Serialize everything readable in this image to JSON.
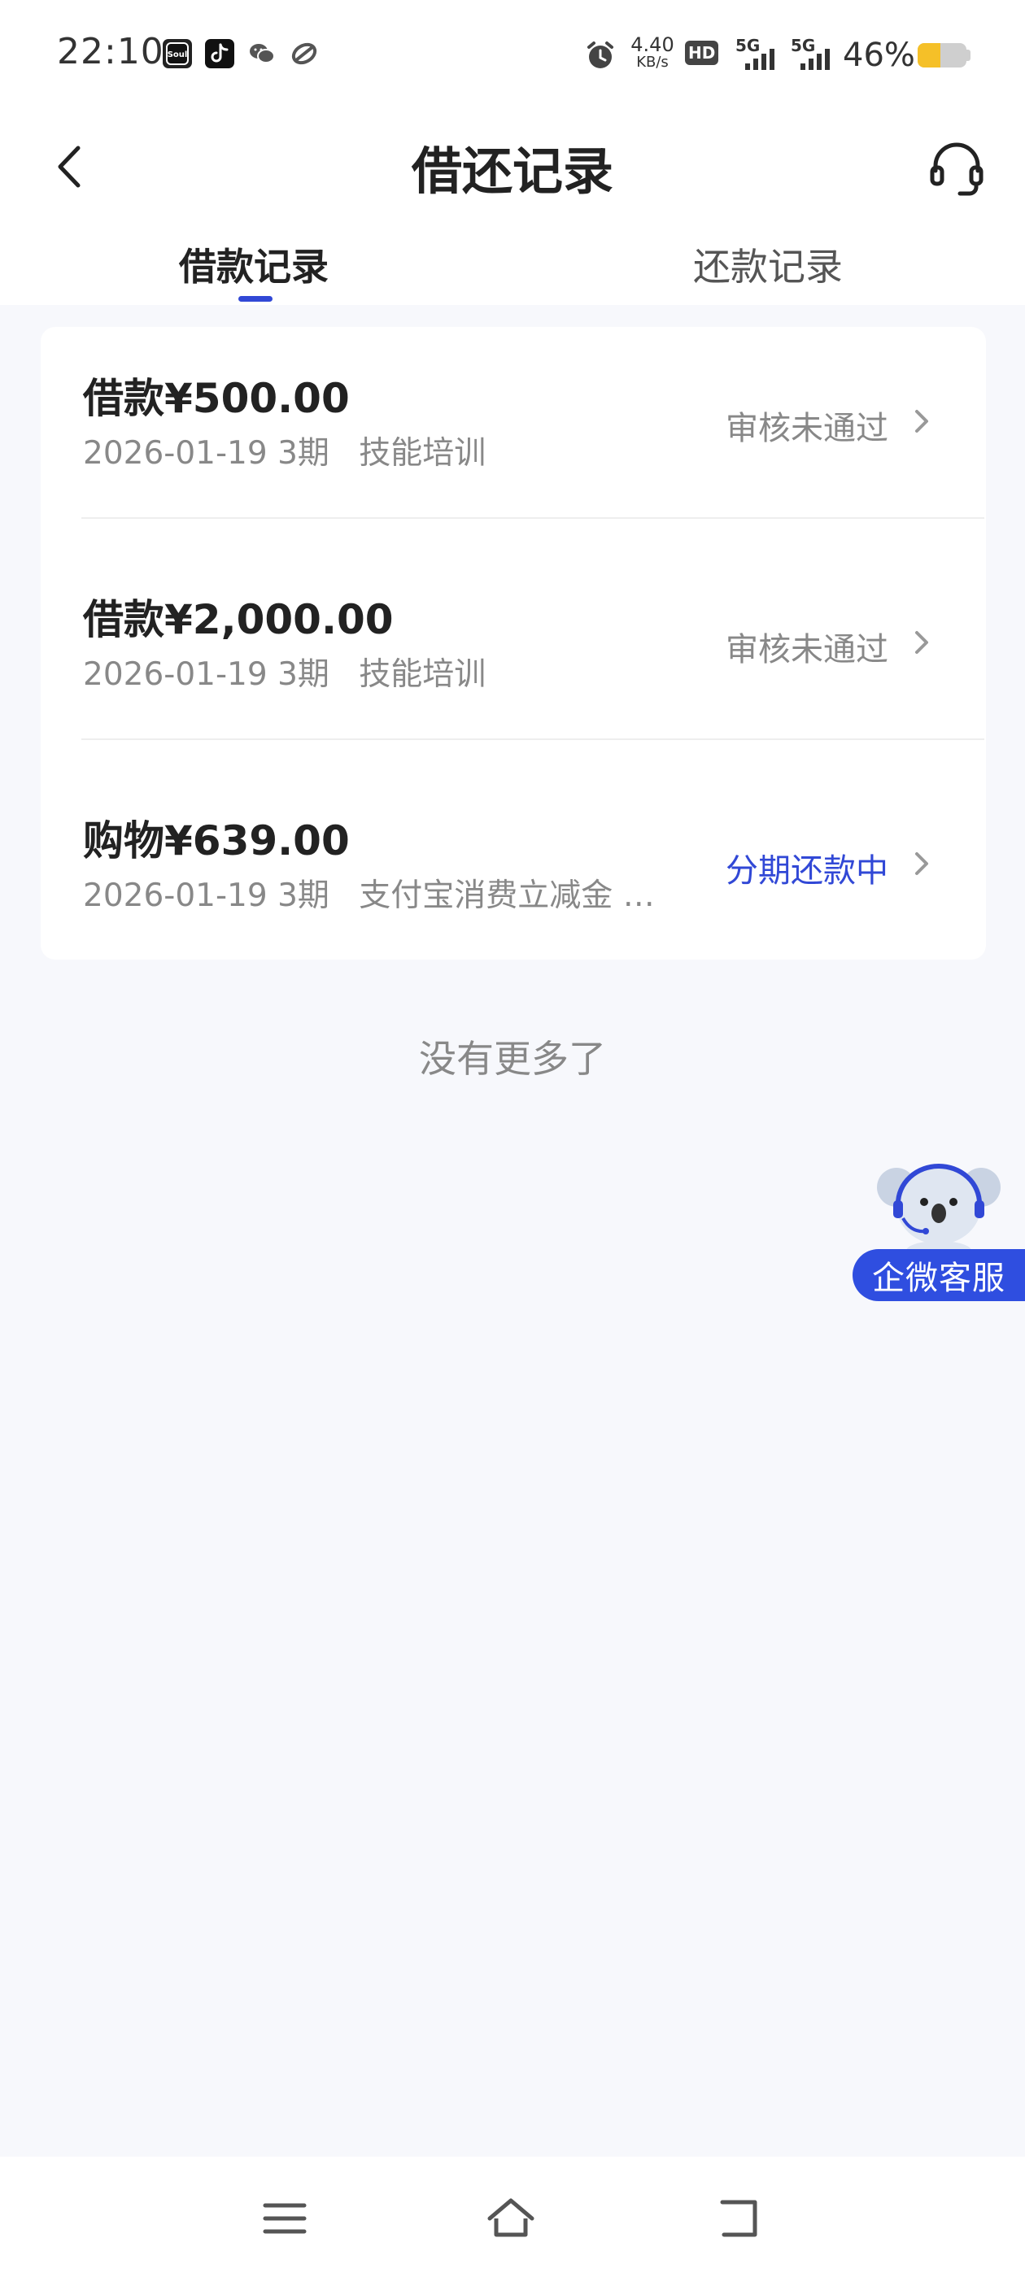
{
  "status_bar": {
    "time": "22:10",
    "app_icons": [
      "soul-icon",
      "tiktok-icon",
      "wechat-icon",
      "link-icon"
    ],
    "net_speed_value": "4.40",
    "net_speed_unit": "KB/s",
    "hd_label": "HD",
    "signal_label_1": "5G",
    "signal_label_2": "5G",
    "battery_percent": "46%",
    "battery_level": 0.46
  },
  "header": {
    "title": "借还记录"
  },
  "tabs": [
    {
      "label": "借款记录",
      "active": true
    },
    {
      "label": "还款记录",
      "active": false
    }
  ],
  "records": [
    {
      "title": "借款¥500.00",
      "date": "2026-01-19",
      "periods": "3期",
      "purpose": "技能培训",
      "status": "审核未通过",
      "status_color": "#888888"
    },
    {
      "title": "借款¥2,000.00",
      "date": "2026-01-19",
      "periods": "3期",
      "purpose": "技能培训",
      "status": "审核未通过",
      "status_color": "#888888"
    },
    {
      "title": "购物¥639.00",
      "date": "2026-01-19",
      "periods": "3期",
      "purpose": "支付宝消费立减金 …",
      "status": "分期还款中",
      "status_color": "#3148d6"
    }
  ],
  "no_more_text": "没有更多了",
  "floating_service": {
    "label": "企微客服"
  },
  "colors": {
    "accent": "#3148d6",
    "background": "#f7f8fc",
    "card": "#ffffff"
  }
}
